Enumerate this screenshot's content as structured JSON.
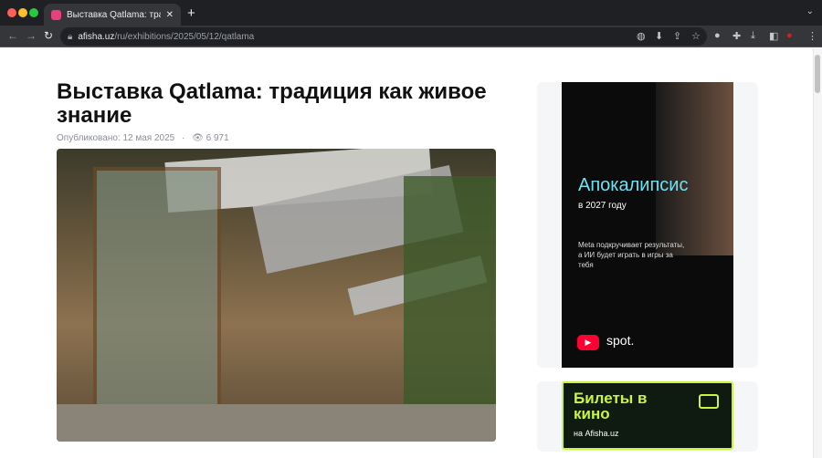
{
  "browser": {
    "tab_title": "Выставка Qatlama: традиция как живое знание",
    "url_domain": "afisha.uz",
    "url_path": "/ru/exhibitions/2025/05/12/qatlama",
    "new_tab": "+",
    "icons": [
      "back-icon",
      "forward-icon",
      "reload-icon",
      "lock-icon",
      "extension-icon",
      "install-icon",
      "share-icon",
      "star-icon",
      "profile-icon",
      "menu-icon"
    ]
  },
  "article": {
    "title": "Выставка Qatlama: традиция как живое знание",
    "published": "Опубликовано: 12 мая 2025",
    "views": "6 971"
  },
  "ads": {
    "spot": {
      "headline": "Апокалипсис",
      "sub": "в 2027 году",
      "desc": "Meta подкручивает результаты, а ИИ будет играть в игры за тебя",
      "brand": "spot."
    },
    "cinema": {
      "headline": "Билеты в кино",
      "sub": "на Afisha.uz"
    }
  }
}
